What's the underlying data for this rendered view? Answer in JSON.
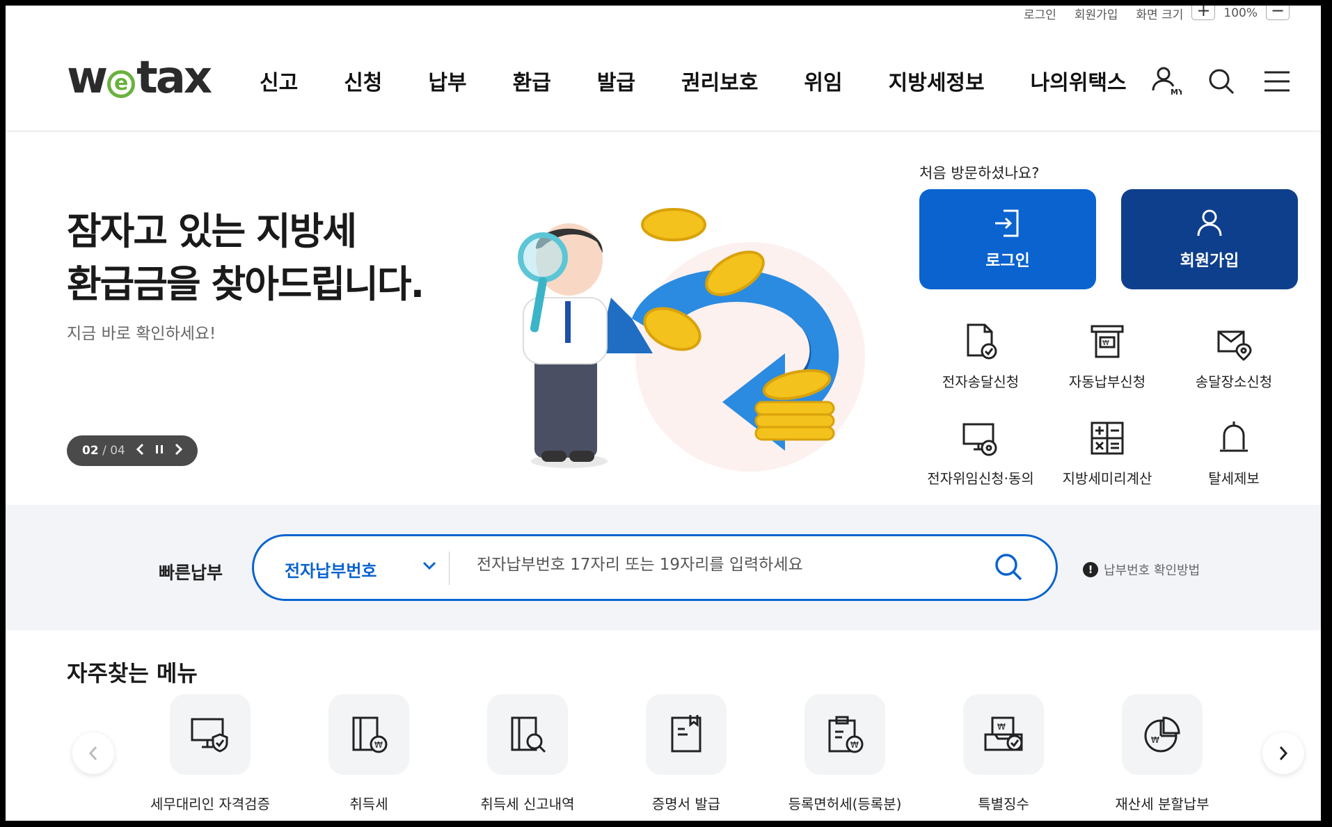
{
  "util": {
    "login": "로그인",
    "join": "회원가입",
    "zoom_label": "화면 크기",
    "zoom_plus": "+",
    "zoom_value": "100%",
    "zoom_minus": "−"
  },
  "header": {
    "logo_w": "w",
    "logo_e": "e",
    "logo_tax": "tax",
    "nav": [
      "신고",
      "신청",
      "납부",
      "환급",
      "발급",
      "권리보호",
      "위임",
      "지방세정보",
      "나의위택스"
    ],
    "icons": [
      "my-icon",
      "search-icon",
      "menu-icon"
    ],
    "my_badge": "MY"
  },
  "hero": {
    "title_line1": "잠자고 있는 지방세",
    "title_line2": "환급금을 찾아드립니다.",
    "subtitle": "지금 바로 확인하세요!",
    "slide_current": "02",
    "slide_sep": " / ",
    "slide_total": "04"
  },
  "panel": {
    "first_visit": "처음 방문하셨나요?",
    "login_label": "로그인",
    "join_label": "회원가입",
    "login_color": "#0a63cf",
    "join_color": "#0e3f8c",
    "quick": [
      {
        "label": "전자송달신청",
        "icon": "e-delivery-icon"
      },
      {
        "label": "자동납부신청",
        "icon": "auto-pay-icon"
      },
      {
        "label": "송달장소신청",
        "icon": "delivery-location-icon"
      },
      {
        "label": "전자위임신청·동의",
        "icon": "e-delegation-icon"
      },
      {
        "label": "지방세미리계산",
        "icon": "calculator-icon"
      },
      {
        "label": "탈세제보",
        "icon": "alarm-bell-icon"
      }
    ]
  },
  "fastpay": {
    "label": "빠른납부",
    "select_value": "전자납부번호",
    "placeholder": "전자납부번호 17자리 또는 19자리를 입력하세요",
    "help_link": "납부번호 확인방법",
    "help_icon": "!"
  },
  "frequent": {
    "title": "자주찾는 메뉴",
    "items": [
      {
        "label": "세무대리인 자격검증",
        "icon": "monitor-shield-icon"
      },
      {
        "label": "취득세",
        "icon": "acquisition-tax-icon"
      },
      {
        "label": "취득세 신고내역",
        "icon": "acquisition-search-icon"
      },
      {
        "label": "증명서 발급",
        "icon": "certificate-icon"
      },
      {
        "label": "등록면허세(등록분)",
        "icon": "clipboard-won-icon"
      },
      {
        "label": "특별징수",
        "icon": "special-collection-icon"
      },
      {
        "label": "재산세 분할납부",
        "icon": "pie-chart-won-icon"
      }
    ]
  }
}
